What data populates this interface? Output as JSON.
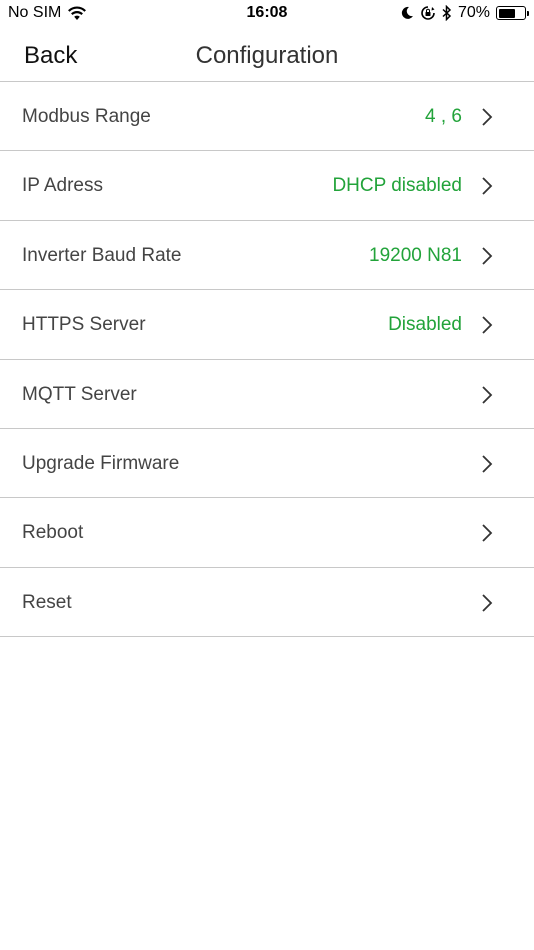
{
  "status_bar": {
    "carrier": "No SIM",
    "time": "16:08",
    "battery_percent": "70%",
    "battery_level": 0.7
  },
  "nav": {
    "back_label": "Back",
    "title": "Configuration"
  },
  "rows": [
    {
      "label": "Modbus Range",
      "value": "4 , 6"
    },
    {
      "label": "IP Adress",
      "value": "DHCP disabled"
    },
    {
      "label": "Inverter Baud Rate",
      "value": "19200 N81"
    },
    {
      "label": "HTTPS Server",
      "value": "Disabled"
    },
    {
      "label": "MQTT Server",
      "value": ""
    },
    {
      "label": "Upgrade Firmware",
      "value": ""
    },
    {
      "label": "Reboot",
      "value": ""
    },
    {
      "label": "Reset",
      "value": ""
    }
  ],
  "colors": {
    "value_green": "#22a33a",
    "divider": "#c8c8c8"
  },
  "icons": {
    "signal": "wifi-icon",
    "moon": "moon-icon",
    "rotation_lock": "rotation-lock-icon",
    "bluetooth": "bluetooth-icon",
    "battery": "battery-icon",
    "chevron": "chevron-right-icon"
  }
}
